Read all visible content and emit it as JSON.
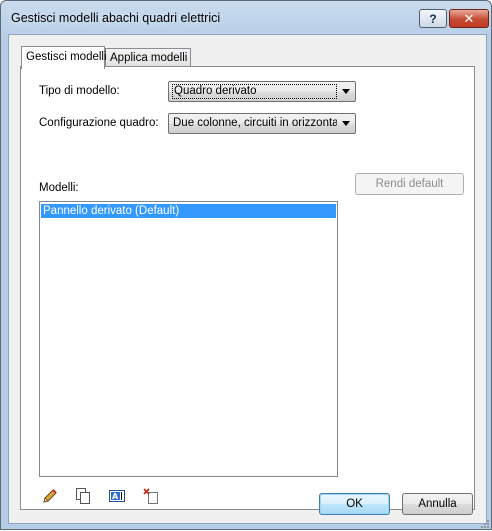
{
  "window": {
    "title": "Gestisci modelli abachi quadri elettrici",
    "help_label": "?",
    "close_label": "✕"
  },
  "tabs": [
    {
      "label": "Gestisci modelli",
      "active": true
    },
    {
      "label": "Applica modelli",
      "active": false
    }
  ],
  "form": {
    "template_type_label": "Tipo di modello:",
    "template_type_value": "Quadro derivato",
    "panel_config_label": "Configurazione quadro:",
    "panel_config_value": "Due colonne, circuiti in orizzontale",
    "models_label": "Modelli:"
  },
  "models": [
    {
      "name": "Pannello derivato (Default)",
      "selected": true
    }
  ],
  "actions": {
    "set_default_label": "Rendi default",
    "icons": [
      "edit-pencil-icon",
      "duplicate-icon",
      "rename-icon",
      "delete-icon"
    ]
  },
  "footer": {
    "ok_label": "OK",
    "cancel_label": "Annulla"
  },
  "colors": {
    "selection": "#3399ff",
    "titlebar": "#b6cde6",
    "close": "#c64b35"
  }
}
